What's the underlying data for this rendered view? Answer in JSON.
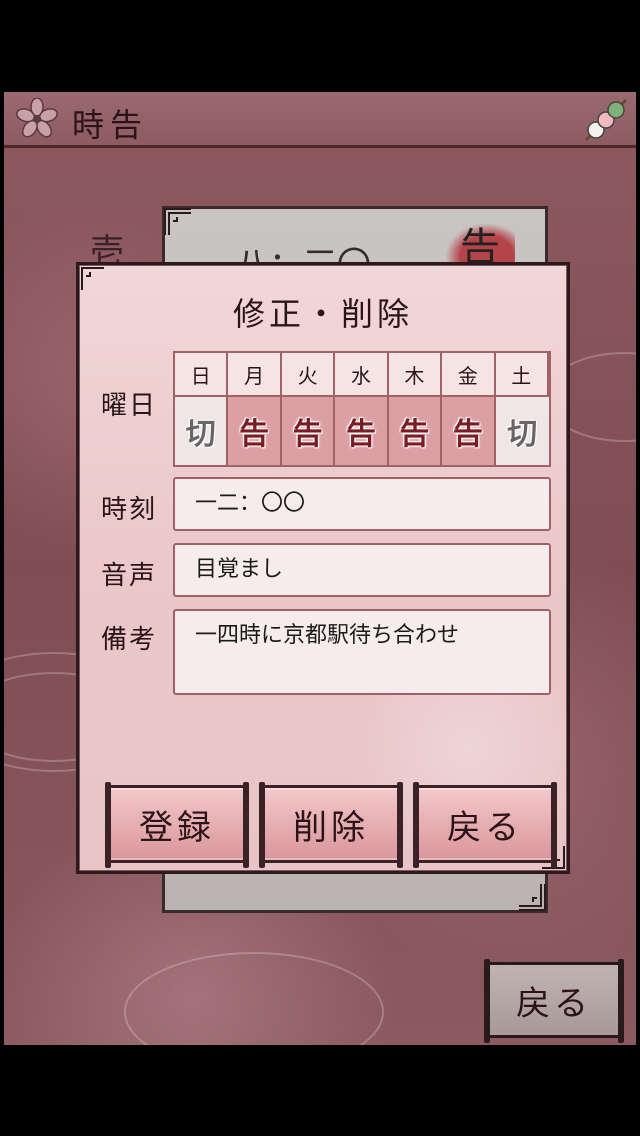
{
  "header": {
    "title": "時告",
    "logo_icon": "sakura-flower-icon",
    "menu_icon": "dango-icon"
  },
  "background_entry": {
    "time": "八：三〇",
    "seal": "告",
    "side_char": "壱"
  },
  "dialog": {
    "title": "修正・削除",
    "weekday_label": "曜日",
    "days": [
      {
        "day": "日",
        "state": "切",
        "active": false
      },
      {
        "day": "月",
        "state": "告",
        "active": true
      },
      {
        "day": "火",
        "state": "告",
        "active": true
      },
      {
        "day": "水",
        "state": "告",
        "active": true
      },
      {
        "day": "木",
        "state": "告",
        "active": true
      },
      {
        "day": "金",
        "state": "告",
        "active": true
      },
      {
        "day": "土",
        "state": "切",
        "active": false
      }
    ],
    "time_label": "時刻",
    "time_value": "一二：〇〇",
    "voice_label": "音声",
    "voice_value": "目覚まし",
    "note_label": "備考",
    "note_value": "一四時に京都駅待ち合わせ",
    "buttons": {
      "register": "登録",
      "delete": "削除",
      "back": "戻る"
    }
  },
  "footer": {
    "back_label": "戻る"
  },
  "colors": {
    "app_bg": "#8e5a60",
    "dialog_bg": "#f2d7d8",
    "active_toggle": "#dc9fa4",
    "ink": "#2a1418"
  }
}
